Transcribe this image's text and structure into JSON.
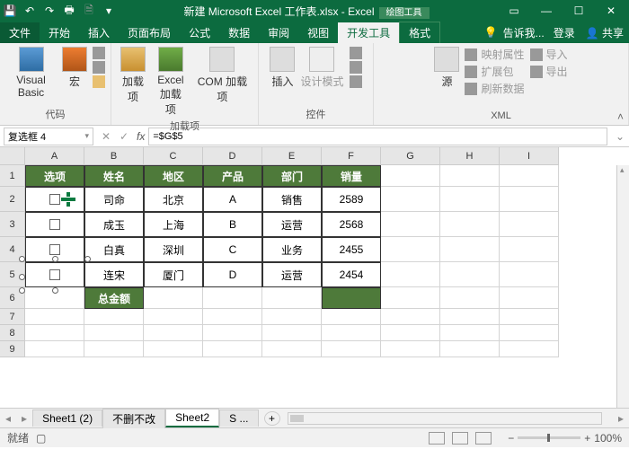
{
  "title": {
    "doc": "新建 Microsoft Excel 工作表.xlsx - Excel",
    "ctx": "绘图工具"
  },
  "menu": {
    "file": "文件",
    "home": "开始",
    "insert": "插入",
    "layout": "页面布局",
    "formula": "公式",
    "data": "数据",
    "review": "审阅",
    "view": "视图",
    "dev": "开发工具",
    "format": "格式",
    "tell": "告诉我...",
    "login": "登录",
    "share": "共享"
  },
  "ribbon": {
    "g1": {
      "vb": "Visual Basic",
      "macro": "宏",
      "label": "代码"
    },
    "g2": {
      "addin": "加载项",
      "excel": "Excel\n加载项",
      "com": "COM 加载项",
      "label": "加载项"
    },
    "g3": {
      "insert": "插入",
      "design": "设计模式",
      "label": "控件"
    },
    "g4": {
      "source": "源",
      "map": "映射属性",
      "expand": "扩展包",
      "refresh": "刷新数据",
      "import": "导入",
      "export": "导出",
      "label": "XML"
    }
  },
  "namebox": "复选框 4",
  "formula": "=$G$5",
  "cols": [
    "A",
    "B",
    "C",
    "D",
    "E",
    "F",
    "G",
    "H",
    "I"
  ],
  "rows": [
    "1",
    "2",
    "3",
    "4",
    "5",
    "6",
    "7",
    "8",
    "9"
  ],
  "headers": {
    "opt": "选项",
    "name": "姓名",
    "region": "地区",
    "product": "产品",
    "dept": "部门",
    "sales": "销量"
  },
  "data": [
    {
      "name": "司命",
      "region": "北京",
      "product": "A",
      "dept": "销售",
      "sales": "2589"
    },
    {
      "name": "成玉",
      "region": "上海",
      "product": "B",
      "dept": "运营",
      "sales": "2568"
    },
    {
      "name": "白真",
      "region": "深圳",
      "product": "C",
      "dept": "业务",
      "sales": "2455"
    },
    {
      "name": "连宋",
      "region": "厦门",
      "product": "D",
      "dept": "运营",
      "sales": "2454"
    }
  ],
  "total": "总金额",
  "tabs": {
    "s1": "Sheet1 (2)",
    "s2": "不删不改",
    "s3": "Sheet2",
    "s4": "S ..."
  },
  "status": {
    "ready": "就绪",
    "zoom": "100%"
  }
}
